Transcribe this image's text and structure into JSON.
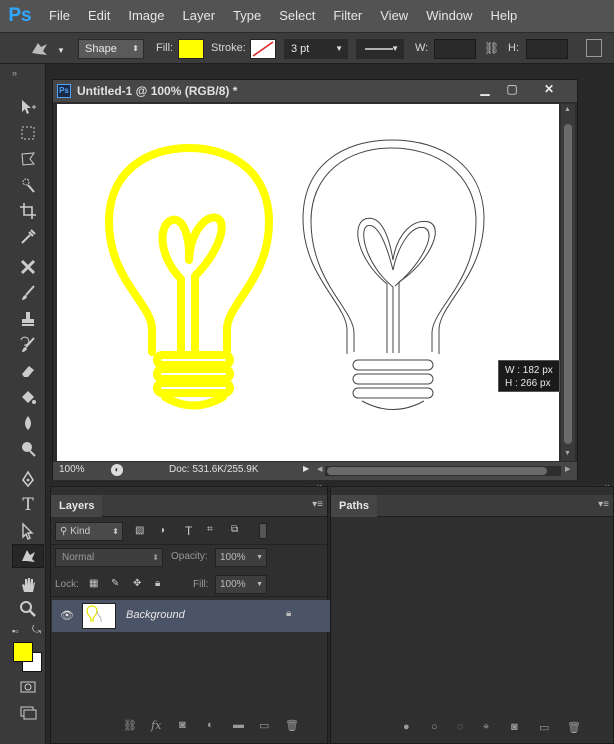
{
  "app": {
    "logo": "Ps"
  },
  "menu": [
    "File",
    "Edit",
    "Image",
    "Layer",
    "Type",
    "Select",
    "Filter",
    "View",
    "Window",
    "Help"
  ],
  "options": {
    "mode": "Shape",
    "fill_label": "Fill:",
    "fill_color": "#ffff00",
    "stroke_label": "Stroke:",
    "stroke_width": "3 pt",
    "w_label": "W:",
    "h_label": "H:"
  },
  "document": {
    "title": "Untitled-1 @ 100% (RGB/8) *",
    "zoom": "100%",
    "doc_size": "Doc: 531.6K/255.9K",
    "measure_w": "W :  182 px",
    "measure_h": "H :  266 px"
  },
  "layers_panel": {
    "tab": "Layers",
    "kind": "Kind",
    "blend": "Normal",
    "opacity_label": "Opacity:",
    "opacity": "100%",
    "lock_label": "Lock:",
    "fill_label": "Fill:",
    "fill": "100%",
    "layer_name": "Background"
  },
  "paths_panel": {
    "tab": "Paths"
  },
  "colors": {
    "foreground": "#ffff00",
    "background": "#ffffff",
    "accent": "#31a8ff"
  }
}
